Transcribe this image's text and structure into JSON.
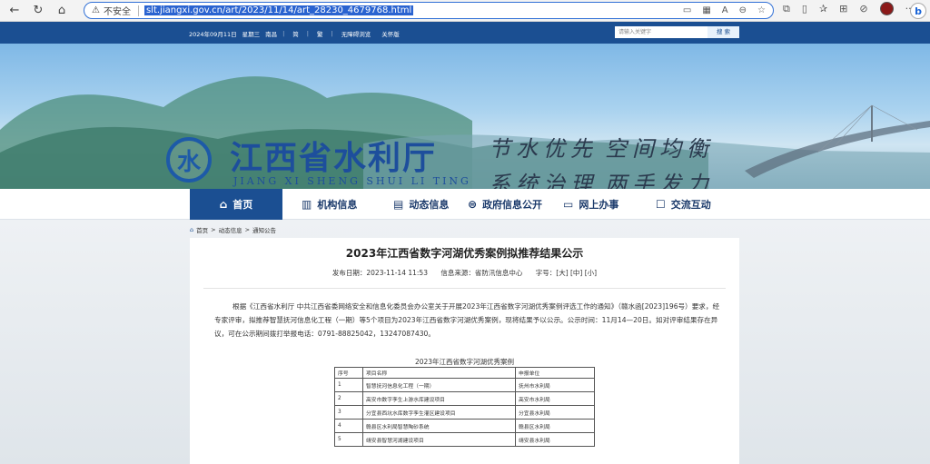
{
  "browser": {
    "insecure_label": "不安全",
    "url": "slt.jiangxi.gov.cn/art/2023/11/14/art_28230_4679768.html",
    "bing_label": "b"
  },
  "topbar": {
    "date": "2024年09月11日",
    "weekday": "星期三",
    "city": "南昌",
    "simplified": "简",
    "traditional": "繁",
    "accessible": "无障碍浏览",
    "elder": "关怀版",
    "search_placeholder": "请输入关键字",
    "search_button": "搜 索"
  },
  "banner": {
    "title": "江西省水利厅",
    "subtitle": "JIANG XI SHENG SHUI LI TING",
    "slogan_1a": "节水优先",
    "slogan_1b": "空间均衡",
    "slogan_2a": "系统治理",
    "slogan_2b": "两手发力"
  },
  "nav": {
    "items": [
      {
        "label": "首页",
        "icon": "home-icon"
      },
      {
        "label": "机构信息",
        "icon": "building-icon"
      },
      {
        "label": "动态信息",
        "icon": "news-icon"
      },
      {
        "label": "政府信息公开",
        "icon": "gov-info-icon"
      },
      {
        "label": "网上办事",
        "icon": "monitor-icon"
      },
      {
        "label": "交流互动",
        "icon": "chat-icon"
      }
    ]
  },
  "breadcrumb": {
    "home": "首页",
    "section": "动态信息",
    "current": "通知公告",
    "separator": ">"
  },
  "article": {
    "title": "2023年江西省数字河湖优秀案例拟推荐结果公示",
    "publish_date": "发布日期：2023-11-14 11:53",
    "source": "信息来源：省防汛信息中心",
    "font_size": "字号：[大] [中] [小]",
    "body": "根据《江西省水利厅 中共江西省委网络安全和信息化委员会办公室关于开展2023年江西省数字河湖优秀案例评选工作的通知》（赣水函[2023]196号）要求，经专家评审，拟推荐智慧抚河信息化工程（一期）等5个项目为2023年江西省数字河湖优秀案例，现将结果予以公示。公示时间：11月14—20日。如对评审结果存在异议，可在公示期间拨打举报电话：0791-88825042，13247087430。",
    "table_title": "2023年江西省数字河湖优秀案例",
    "table": {
      "headers": [
        "序号",
        "项目名称",
        "申报单位"
      ],
      "rows": [
        [
          "1",
          "智慧抚河信息化工程（一期）",
          "抚州市水利局"
        ],
        [
          "2",
          "高安市数字孪生上游水库建设项目",
          "高安市水利局"
        ],
        [
          "3",
          "分宜县西坑水库数字孪生灌区建设项目",
          "分宜县水利局"
        ],
        [
          "4",
          "赣县区水利局智慧陶砂系统",
          "赣县区水利局"
        ],
        [
          "5",
          "靖安县智慧河湖建设项目",
          "靖安县水利局"
        ]
      ]
    }
  },
  "colors": {
    "primary": "#1b4f92",
    "title_blue": "#1d4e9c"
  }
}
